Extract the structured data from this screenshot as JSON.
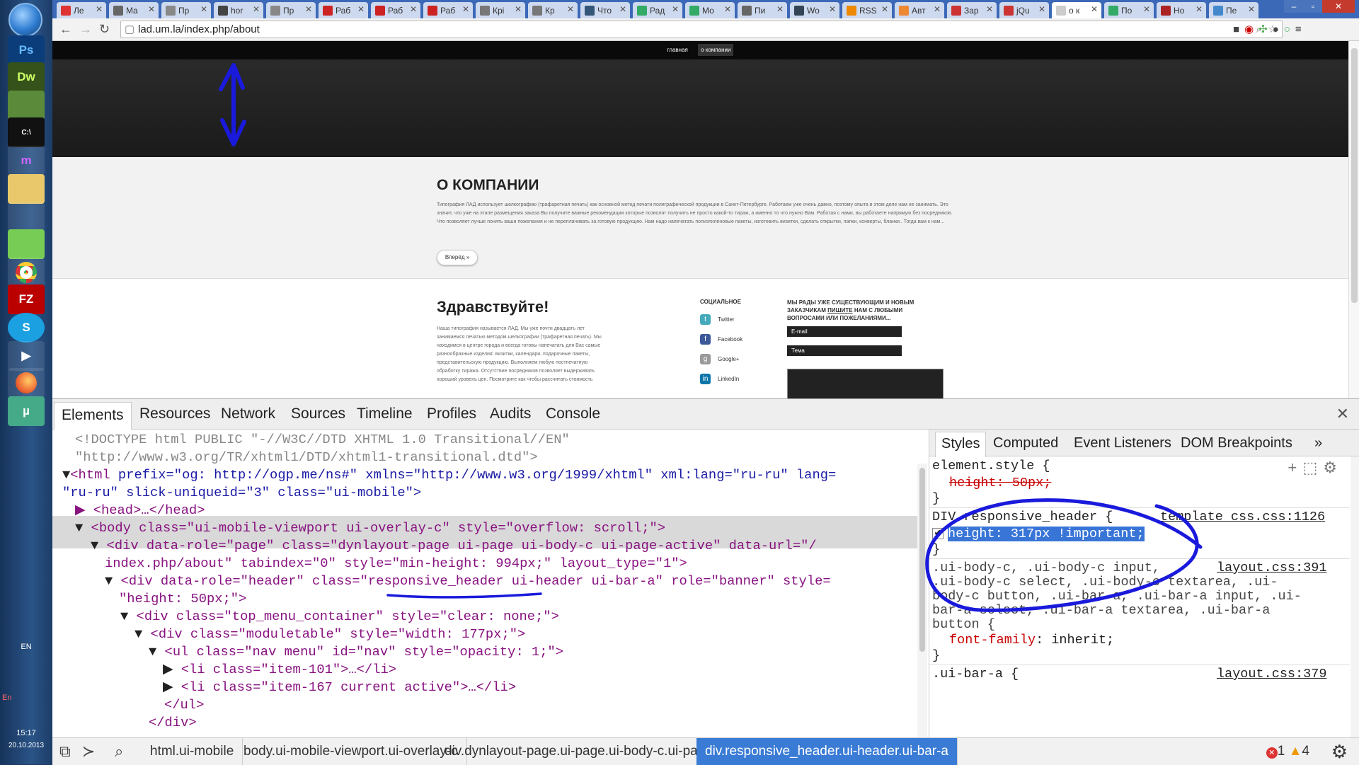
{
  "taskbar": {
    "apps": [
      "Ps",
      "Dw",
      "",
      "C:\\",
      "",
      "",
      "",
      "",
      "",
      "",
      "FZ",
      "S",
      "",
      "",
      ""
    ],
    "lang": "EN",
    "lang2": "En",
    "time": "15:17",
    "date": "20.10.2013"
  },
  "browser": {
    "tabs": [
      {
        "label": "Ле",
        "color": "#d33"
      },
      {
        "label": "Ma",
        "color": "#666"
      },
      {
        "label": "Пр",
        "color": "#888"
      },
      {
        "label": "hor",
        "color": "#444"
      },
      {
        "label": "Пр",
        "color": "#888"
      },
      {
        "label": "Раб",
        "color": "#c22"
      },
      {
        "label": "Раб",
        "color": "#c22"
      },
      {
        "label": "Раб",
        "color": "#c22"
      },
      {
        "label": "Крі",
        "color": "#777"
      },
      {
        "label": "Кр",
        "color": "#777"
      },
      {
        "label": "Что",
        "color": "#357"
      },
      {
        "label": "Рад",
        "color": "#3a6"
      },
      {
        "label": "Мо",
        "color": "#3a6"
      },
      {
        "label": "Пи",
        "color": "#666"
      },
      {
        "label": "Wo",
        "color": "#345"
      },
      {
        "label": "RSS",
        "color": "#e80"
      },
      {
        "label": "Авт",
        "color": "#e83"
      },
      {
        "label": "Зар",
        "color": "#c33"
      },
      {
        "label": "jQu",
        "color": "#c33"
      },
      {
        "label": "o к",
        "color": "#ccc"
      },
      {
        "label": "По",
        "color": "#3a6"
      },
      {
        "label": "Но",
        "color": "#a22"
      },
      {
        "label": "Пе",
        "color": "#48c"
      }
    ],
    "active_tab": 19,
    "url": "lad.um.la/index.php/about"
  },
  "site": {
    "nav": [
      "главная",
      "о компании"
    ],
    "about_title": "О КОМПАНИИ",
    "about_text": "Типография ЛАД использует шелкографию (трафаретная печать) как основной метод печати полиграфической продукции в Санкт-Петербурге. Работаем уже очень давно, поэтому опыта в этом деле нам не занимать. Это значит, что уже на этапе размещения заказа Вы получите важные рекомендации которые позволят получить не просто какой-то тираж, а именно то что нужно Вам. Работая с нами, вы работаете напрямую без посредников. Что позволяет лучше понять ваши пожелания и не переплачивать за готовую продукцию. Нам надо напечатать полиэтиленовые пакеты, изготовить визитки, сделать открытки, папки, конверты, бланки.. Тогда вам к нам...",
    "forward_btn": "Вперёд »",
    "hello_title": "Здравствуйте!",
    "hello_text": "Наша типография называется ЛАД. Мы уже почти двадцать лет занимаемся печатью методом шелкографии (трафаретная печать). Мы находимся в центре города и всегда готовы напечатать для Вас самые разнообразные изделия: визитки, календари, подарочные пакеты, представительскую продукцию. Выполняем любую постпечатную обработку тиража. Отсутствие посредников позволяет выдерживать хороший уровень цен. Посмотрите как чтобы рассчитать стоимость",
    "social_title": "СОЦИАЛЬНОЕ",
    "social": [
      {
        "label": "Twitter",
        "color": "#4ab",
        "glyph": "t"
      },
      {
        "label": "Facebook",
        "color": "#3b5998",
        "glyph": "f"
      },
      {
        "label": "Google+",
        "color": "#999",
        "glyph": "g"
      },
      {
        "label": "LinkedIn",
        "color": "#0e76a8",
        "glyph": "in"
      }
    ],
    "contact_text_1": "МЫ РАДЫ УЖЕ СУЩЕСТВУЮЩИМ И НОВЫМ ЗАКАЗЧИКАМ ",
    "contact_link": "ПИШИТЕ",
    "contact_text_2": " НАМ С ЛЮБЫМИ ВОПРОСАМИ ИЛИ ПОЖЕЛАНИЯМИ...",
    "email_placeholder": "E-mail",
    "subject_placeholder": "Тема"
  },
  "devtools": {
    "tabs": [
      "Elements",
      "Resources",
      "Network",
      "Sources",
      "Timeline",
      "Profiles",
      "Audits",
      "Console"
    ],
    "active_tab": "Elements",
    "dom": {
      "doctype1": "<!DOCTYPE html PUBLIC \"-//W3C//DTD XHTML 1.0 Transitional//EN\"",
      "doctype2": "\"http://www.w3.org/TR/xhtml1/DTD/xhtml1-transitional.dtd\">",
      "html_open": "<html",
      "html_attrs": " prefix=\"og: http://ogp.me/ns#\" xmlns=\"http://www.w3.org/1999/xhtml\" xml:lang=\"ru-ru\" lang=",
      "html_attrs2": "\"ru-ru\" slick-uniqueid=\"3\" class=\"ui-mobile\">",
      "head": "<head>…</head>",
      "body": "<body class=\"ui-mobile-viewport ui-overlay-c\" style=\"overflow: scroll;\">",
      "div_page1": "<div data-role=\"page\" class=\"dynlayout-page ui-page ui-body-c ui-page-active\" data-url=\"/",
      "div_page2": "index.php/about\" tabindex=\"0\" style=\"min-height: 994px;\" layout_type=\"1\">",
      "div_header1": "<div data-role=\"header\" class=\"responsive_header ui-header ui-bar-a\" role=\"banner\" style=",
      "div_header2": "\"height: 50px;\">",
      "top_menu": "<div class=\"top_menu_container\" style=\"clear: none;\">",
      "moduletable": "<div class=\"moduletable\" style=\"width: 177px;\">",
      "ul_nav": "<ul class=\"nav menu\" id=\"nav\" style=\"opacity: 1;\">",
      "li1": "<li class=\"item-101\">…</li>",
      "li2": "<li class=\"item-167 current active\">…</li>",
      "ul_close": "</ul>",
      "div_close": "</div>"
    },
    "styles_tabs": [
      "Styles",
      "Computed",
      "Event Listeners",
      "DOM Breakpoints"
    ],
    "styles": {
      "element_style": "element.style {",
      "el_prop": "height: 50px;",
      "close": "}",
      "sel2": "DIV.responsive_header {",
      "src2": "template_css.css:1126",
      "prop2": "height: 317px !important;",
      "sel3a": ".ui-body-c, .ui-body-c input,",
      "src3": "layout.css:391",
      "sel3b": ".ui-body-c select, .ui-body-c textarea, .ui-",
      "sel3c": "body-c button, .ui-bar-a, .ui-bar-a input, .ui-",
      "sel3d": "bar-a select, .ui-bar-a textarea, .ui-bar-a",
      "sel3e": "button {",
      "prop3_name": "font-family",
      "prop3_val": ": inherit;",
      "sel4": ".ui-bar-a {",
      "src4": "layout.css:379"
    },
    "breadcrumbs": [
      "html.ui-mobile",
      "body.ui-mobile-viewport.ui-overlay-c",
      "div.dynlayout-page.ui-page.ui-body-c.ui-page-active",
      "div.responsive_header.ui-header.ui-bar-a"
    ],
    "errors": "1",
    "warnings": "4"
  },
  "colors": {
    "annotation": "#1a1adc",
    "selected": "#3a7bd5"
  }
}
